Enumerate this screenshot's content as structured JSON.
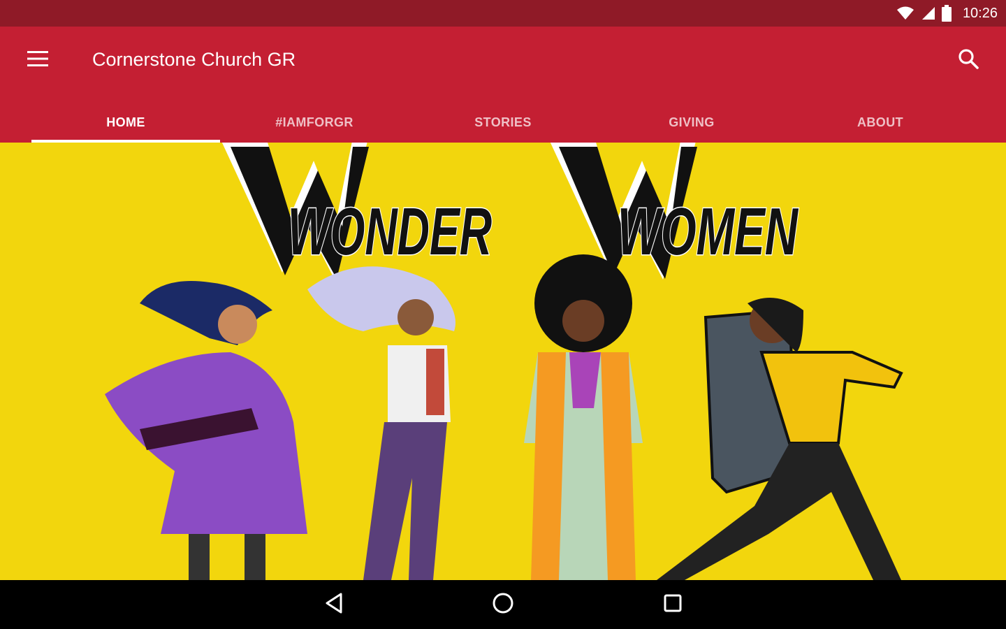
{
  "status_bar": {
    "time": "10:26",
    "icons": [
      "wifi-icon",
      "cell-signal-icon",
      "battery-icon"
    ]
  },
  "app_bar": {
    "title": "Cornerstone Church GR",
    "menu_icon": "hamburger-menu-icon",
    "search_icon": "search-icon",
    "background_color": "#c41f33",
    "status_color": "#8f1a27"
  },
  "tabs": [
    {
      "label": "HOME",
      "active": true
    },
    {
      "label": "#IAMFORGR",
      "active": false
    },
    {
      "label": "STORIES",
      "active": false
    },
    {
      "label": "GIVING",
      "active": false
    },
    {
      "label": "ABOUT",
      "active": false
    }
  ],
  "hero": {
    "word_one": "WONDER",
    "word_two": "WOMEN",
    "background_color": "#f2d60d"
  },
  "nav_bar": {
    "back_icon": "back-triangle-icon",
    "home_icon": "home-circle-icon",
    "recents_icon": "recents-square-icon"
  }
}
